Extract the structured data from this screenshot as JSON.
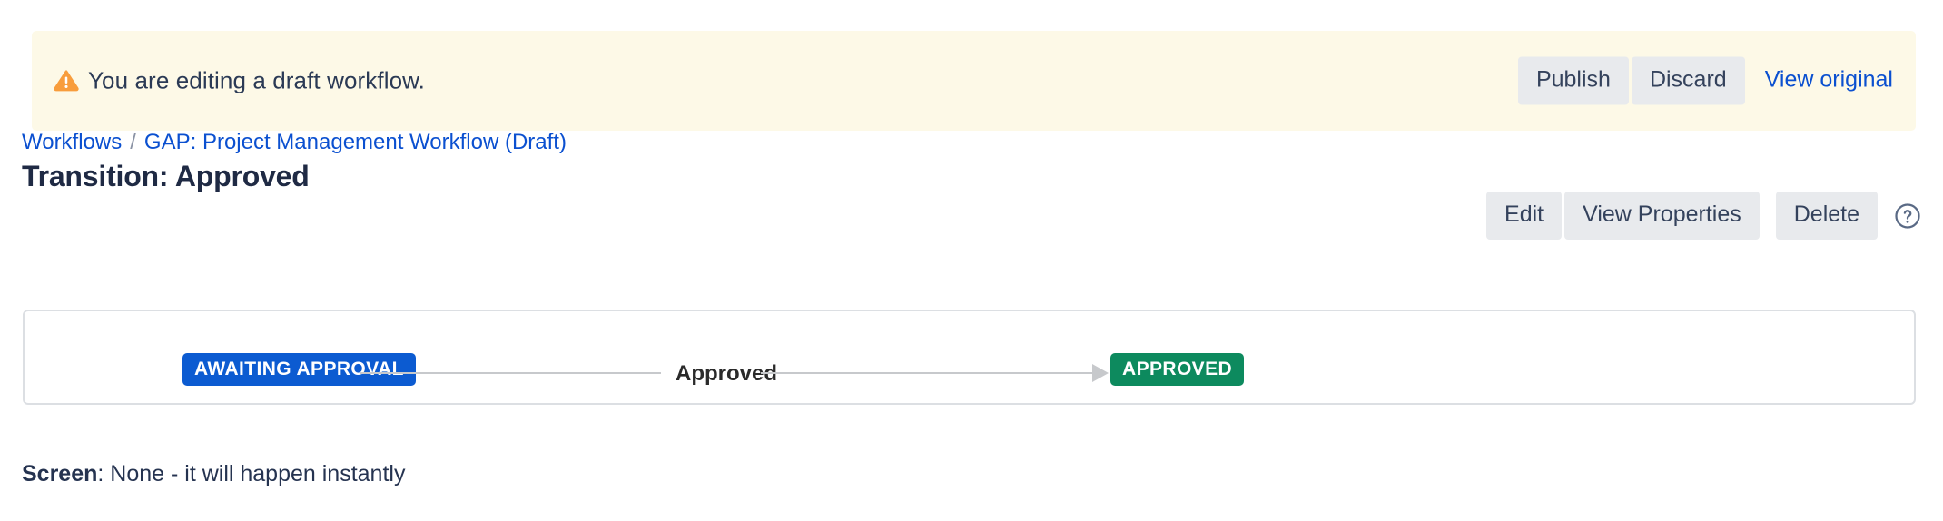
{
  "banner": {
    "icon": "warning-triangle-icon",
    "icon_color": "#f89d3c",
    "background": "#fdf9e7",
    "message": "You are editing a draft workflow.",
    "publish_label": "Publish",
    "discard_label": "Discard",
    "view_original_label": "View original"
  },
  "breadcrumb": {
    "root_label": "Workflows",
    "separator": "/",
    "current_label": "GAP: Project Management Workflow (Draft)",
    "link_color": "#0b50d0"
  },
  "header": {
    "title": "Transition: Approved",
    "actions": {
      "edit_label": "Edit",
      "view_properties_label": "View Properties",
      "delete_label": "Delete",
      "help_icon": "question-circle-icon"
    }
  },
  "transition": {
    "from_status": "AWAITING APPROVAL",
    "from_status_color": "#0c5bd1",
    "transition_name": "Approved",
    "to_status": "APPROVED",
    "to_status_color": "#0d8a5e"
  },
  "details": {
    "screen_label": "Screen",
    "screen_value": ": None - it will happen instantly"
  }
}
